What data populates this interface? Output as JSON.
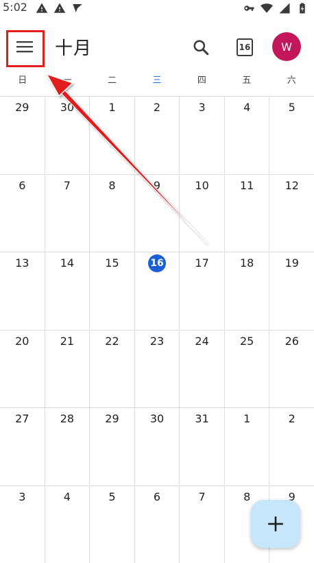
{
  "status_bar": {
    "time": "5:02"
  },
  "app_bar": {
    "month_title": "十月",
    "today_number": "16",
    "avatar_initial": "W"
  },
  "weekdays": [
    "日",
    "一",
    "二",
    "三",
    "四",
    "五",
    "六"
  ],
  "current_weekday_index": 3,
  "weeks": [
    [
      "29",
      "30",
      "1",
      "2",
      "3",
      "4",
      "5"
    ],
    [
      "6",
      "7",
      "8",
      "9",
      "10",
      "11",
      "12"
    ],
    [
      "13",
      "14",
      "15",
      "16",
      "17",
      "18",
      "19"
    ],
    [
      "20",
      "21",
      "22",
      "23",
      "24",
      "25",
      "26"
    ],
    [
      "27",
      "28",
      "29",
      "30",
      "31",
      "1",
      "2"
    ],
    [
      "3",
      "4",
      "5",
      "6",
      "7",
      "8",
      "9"
    ]
  ],
  "today": {
    "week": 2,
    "day": 3
  },
  "colors": {
    "accent": "#1a73e8",
    "today_fill": "#1a5fd6",
    "avatar": "#c2185b",
    "fab": "#c7e6fb",
    "annotation": "#e11d1d"
  },
  "icons": {
    "menu": "hamburger-menu-icon",
    "search": "search-icon",
    "today": "calendar-today-icon",
    "fab": "plus-icon"
  }
}
